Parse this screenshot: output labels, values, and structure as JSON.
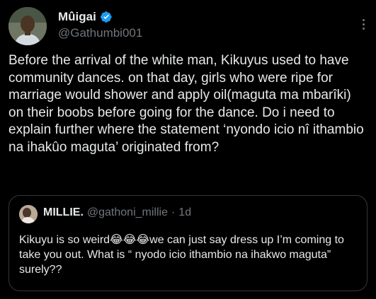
{
  "tweet": {
    "author": {
      "display_name": "Mûigai",
      "handle": "@Gathumbi001",
      "verified": true,
      "avatar_icon": "profile-photo"
    },
    "more_icon": "more-options-icon",
    "text": "Before the arrival of the white man, Kikuyus used to have community dances. on that day, girls who were ripe for marriage would shower and apply oil(maguta ma mbarîki) on their boobs before going for the dance. Do i need to explain further where the statement ‘nyondo icio nî ithambio na ihakûo maguta’ originated from?"
  },
  "quote": {
    "author": {
      "display_name": "MILLIE.",
      "handle": "@gathoni_millie",
      "separator": "·",
      "time": "1d",
      "avatar_icon": "profile-photo"
    },
    "text": "Kikuyu is so weird😂😂😂we can just say dress up I’m coming to take you out.  What is “ nyodo icio ithambio na ihakwo maguta” surely??"
  },
  "colors": {
    "background": "#000000",
    "primary_text": "#e7e9ea",
    "secondary_text": "#71767b",
    "verified_blue": "#1d9bf0",
    "border": "#333639"
  }
}
